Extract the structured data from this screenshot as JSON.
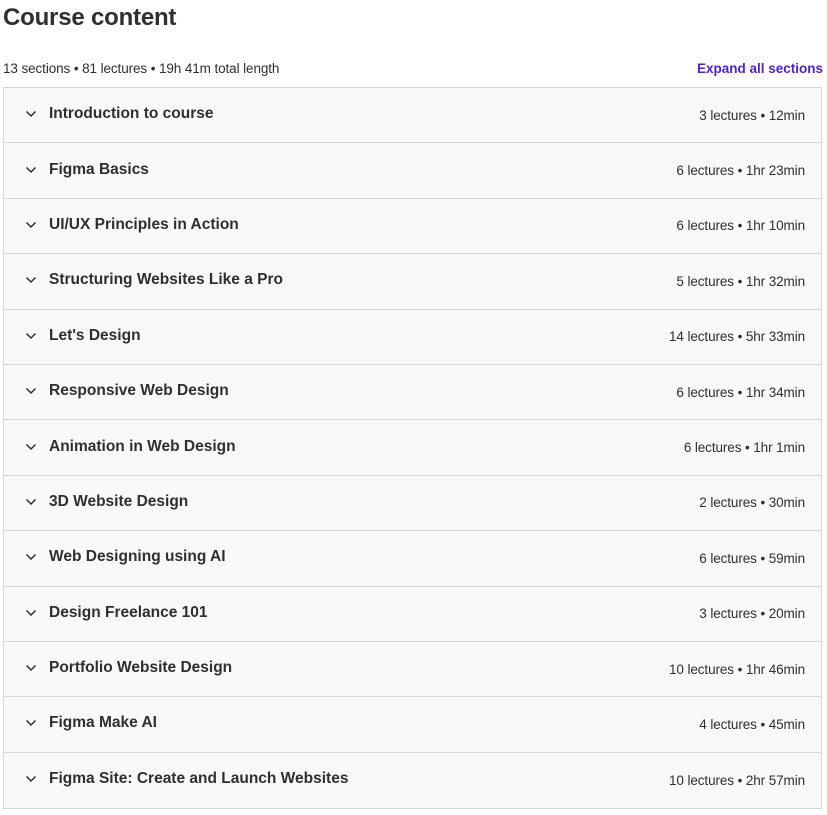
{
  "title": "Course content",
  "summary": "13 sections • 81 lectures • 19h 41m total length",
  "expand_all_label": "Expand all sections",
  "sections": [
    {
      "title": "Introduction to course",
      "meta": "3 lectures • 12min"
    },
    {
      "title": "Figma Basics",
      "meta": "6 lectures • 1hr 23min"
    },
    {
      "title": "UI/UX Principles in Action",
      "meta": "6 lectures • 1hr 10min"
    },
    {
      "title": "Structuring Websites Like a Pro",
      "meta": "5 lectures • 1hr 32min"
    },
    {
      "title": "Let's Design",
      "meta": "14 lectures • 5hr 33min"
    },
    {
      "title": "Responsive Web Design",
      "meta": "6 lectures • 1hr 34min"
    },
    {
      "title": "Animation in Web Design",
      "meta": "6 lectures • 1hr 1min"
    },
    {
      "title": "3D Website Design",
      "meta": "2 lectures • 30min"
    },
    {
      "title": "Web Designing using AI",
      "meta": "6 lectures • 59min"
    },
    {
      "title": "Design Freelance 101",
      "meta": "3 lectures • 20min"
    },
    {
      "title": "Portfolio Website Design",
      "meta": "10 lectures • 1hr 46min"
    },
    {
      "title": "Figma Make AI",
      "meta": "4 lectures • 45min"
    },
    {
      "title": "Figma Site: Create and Launch Websites",
      "meta": "10 lectures • 2hr 57min"
    }
  ],
  "icon": "chevron-down-icon",
  "colors": {
    "accent": "#5022c3",
    "section_bg": "#f7f9fa",
    "border": "#d1d7dc",
    "text": "#2d2f31"
  }
}
